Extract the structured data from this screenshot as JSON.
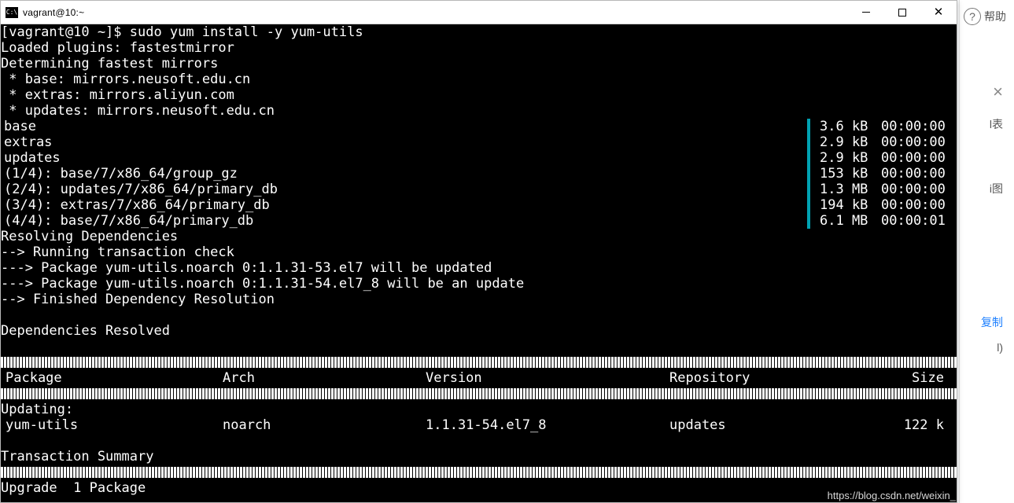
{
  "window": {
    "title": "vagrant@10:~",
    "icon_text": "C:\\"
  },
  "side": {
    "help_label": "帮助",
    "biao": "l表",
    "tu": "i图",
    "copy": "复制",
    "paren": "l)"
  },
  "prompt_line": "[vagrant@10 ~]$ sudo yum install -y yum-utils",
  "plain_lines_top": [
    "Loaded plugins: fastestmirror",
    "Determining fastest mirrors",
    " * base: mirrors.neusoft.edu.cn",
    " * extras: mirrors.aliyun.com",
    " * updates: mirrors.neusoft.edu.cn"
  ],
  "progress_rows": [
    {
      "name": "base",
      "size": "3.6 kB",
      "time": "00:00:00"
    },
    {
      "name": "extras",
      "size": "2.9 kB",
      "time": "00:00:00"
    },
    {
      "name": "updates",
      "size": "2.9 kB",
      "time": "00:00:00"
    },
    {
      "name": "(1/4): base/7/x86_64/group_gz",
      "size": "153 kB",
      "time": "00:00:00"
    },
    {
      "name": "(2/4): updates/7/x86_64/primary_db",
      "size": "1.3 MB",
      "time": "00:00:00"
    },
    {
      "name": "(3/4): extras/7/x86_64/primary_db",
      "size": "194 kB",
      "time": "00:00:00"
    },
    {
      "name": "(4/4): base/7/x86_64/primary_db",
      "size": "6.1 MB",
      "time": "00:00:01"
    }
  ],
  "dep_lines": [
    "Resolving Dependencies",
    "--> Running transaction check",
    "---> Package yum-utils.noarch 0:1.1.31-53.el7 will be updated",
    "---> Package yum-utils.noarch 0:1.1.31-54.el7_8 will be an update",
    "--> Finished Dependency Resolution",
    "",
    "Dependencies Resolved",
    ""
  ],
  "table": {
    "headers": {
      "pkg": " Package",
      "arch": "Arch",
      "ver": "Version",
      "repo": "Repository",
      "size": "Size"
    },
    "section_label": "Updating:",
    "rows": [
      {
        "pkg": " yum-utils",
        "arch": "noarch",
        "ver": "1.1.31-54.el7_8",
        "repo": "updates",
        "size": "122 k"
      }
    ]
  },
  "trailer_lines": [
    "",
    "Transaction Summary"
  ],
  "upgrade_line": "Upgrade  1 Package",
  "watermark": "https://blog.csdn.net/weixin_"
}
